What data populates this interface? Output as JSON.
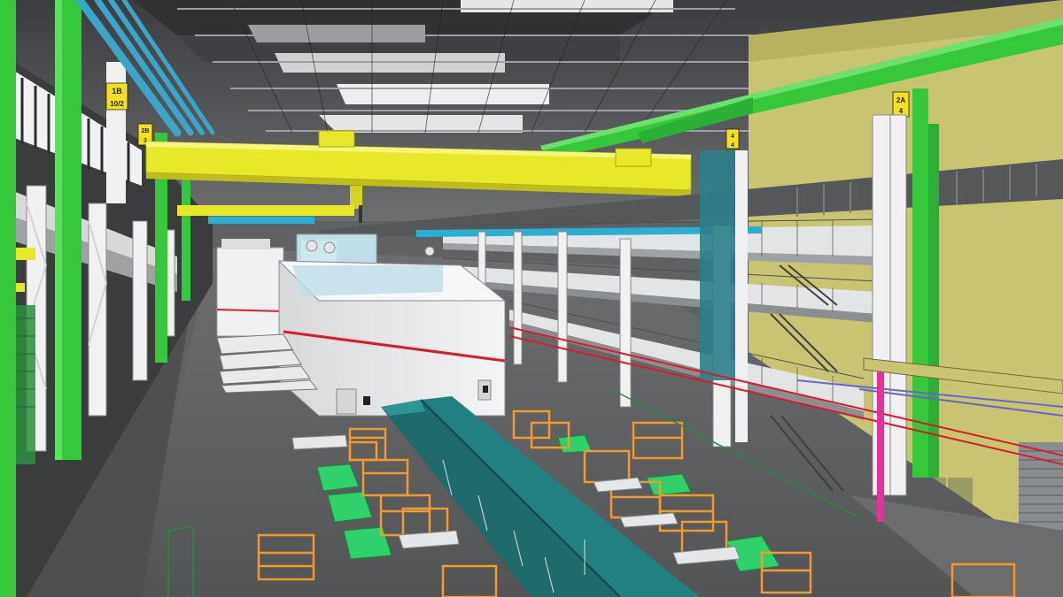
{
  "scene": {
    "kind": "3D BIM model render of a press-shop industrial hall",
    "elements": [
      "overhead-crane",
      "press-line",
      "conveyor",
      "mezzanine-walkways",
      "steel-columns",
      "ventilation-ducts",
      "parts-racks",
      "roller-door"
    ]
  },
  "column_labels": [
    {
      "id": "1B",
      "line1": "1B",
      "line2": "10/2"
    },
    {
      "id": "2B",
      "line1": "2B",
      "line2": "3"
    },
    {
      "id": "2A",
      "line1": "2A",
      "line2": "4"
    },
    {
      "id": "mid",
      "line1": "4",
      "line2": "4"
    }
  ],
  "colors": {
    "crane": "#e8e82a",
    "column_green": "#34c83a",
    "wall_olive": "#c9c471",
    "floor": "#5e6062",
    "press_body": "#ebeded",
    "conveyor": "#1f6a6a",
    "racks": "#f39a2e",
    "pallets": "#2fd16a",
    "pipes_blue": "#3aa6c8",
    "stripe_red": "#d81c2c"
  }
}
